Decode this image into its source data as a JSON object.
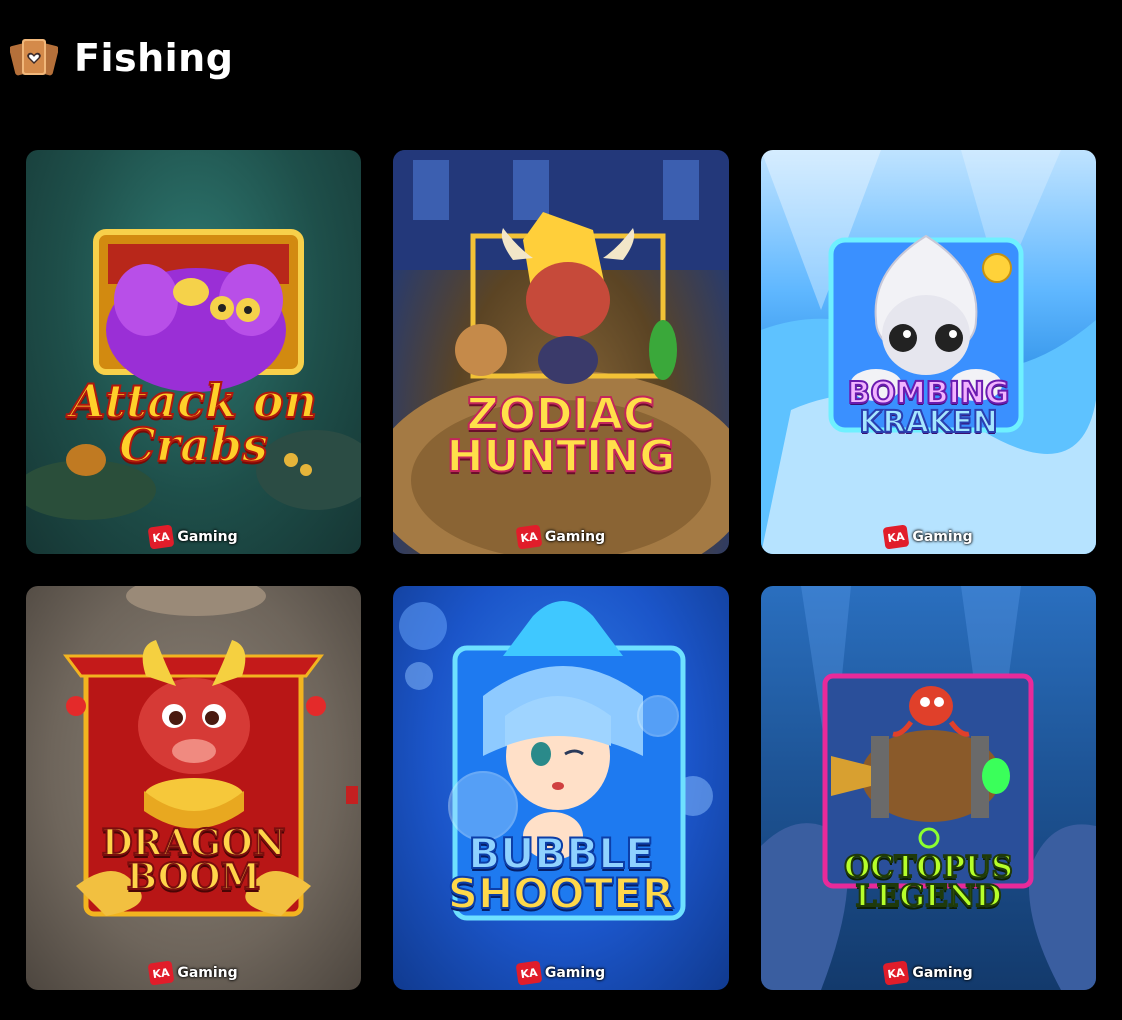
{
  "section": {
    "title": "Fishing",
    "icon": "playing-cards-icon"
  },
  "games": [
    {
      "title_line1": "Attack on",
      "title_line2": "Crabs",
      "provider": "Gaming",
      "provider_badge": "KA"
    },
    {
      "title_line1": "ZODIAC",
      "title_line2": "HUNTING",
      "provider": "Gaming",
      "provider_badge": "KA"
    },
    {
      "title_line1": "BOMBING",
      "title_line2": "KRAKEN",
      "provider": "Gaming",
      "provider_badge": "KA"
    },
    {
      "title_line1": "DRAGON",
      "title_line2": "BOOM",
      "provider": "Gaming",
      "provider_badge": "KA"
    },
    {
      "title_line1": "BUBBLE",
      "title_line2": "SHOOTER",
      "provider": "Gaming",
      "provider_badge": "KA"
    },
    {
      "title_line1": "OCTOPUS",
      "title_line2": "LEGEND",
      "provider": "Gaming",
      "provider_badge": "KA"
    }
  ],
  "colors": {
    "background": "#000000",
    "header_text": "#ffffff",
    "provider_red": "#e11d2a"
  }
}
